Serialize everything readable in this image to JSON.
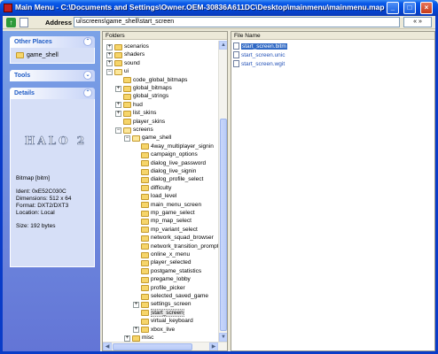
{
  "window": {
    "title": "Main Menu - C:\\Documents and Settings\\Owner.OEM-30836A611DC\\Desktop\\mainmenu\\mainmenu.map",
    "min_glyph": "_",
    "max_glyph": "□",
    "close_glyph": "×"
  },
  "address": {
    "label": "Address",
    "value": "ui\\screens\\game_shell\\start_screen",
    "go_label": "« »"
  },
  "taskpane": {
    "other_places": {
      "title": "Other Places",
      "link": "game_shell"
    },
    "tools": {
      "title": "Tools"
    },
    "details": {
      "title": "Details",
      "logo": "HALO 2",
      "type": "Bitmap [bitm]",
      "ident": "Ident: 0xE52C030C",
      "dimensions": "Dimensions: 512 x 64",
      "format": "Format: DXT2/DXT3",
      "location": "Location: Local",
      "size": "Size: 192 bytes"
    }
  },
  "folders": {
    "header": "Folders",
    "items": [
      {
        "label": "scenarios",
        "exp": "+"
      },
      {
        "label": "shaders",
        "exp": "+"
      },
      {
        "label": "sound",
        "exp": "+"
      },
      {
        "label": "ui",
        "exp": "−"
      },
      {
        "label": "code_global_bitmaps",
        "exp": ""
      },
      {
        "label": "global_bitmaps",
        "exp": "+"
      },
      {
        "label": "global_strings",
        "exp": ""
      },
      {
        "label": "hud",
        "exp": "+"
      },
      {
        "label": "list_skins",
        "exp": "+"
      },
      {
        "label": "player_skins",
        "exp": ""
      },
      {
        "label": "screens",
        "exp": "−"
      },
      {
        "label": "game_shell",
        "exp": "−"
      },
      {
        "label": "4way_multiplayer_signin",
        "exp": ""
      },
      {
        "label": "campaign_options",
        "exp": ""
      },
      {
        "label": "dialog_live_password",
        "exp": ""
      },
      {
        "label": "dialog_live_signin",
        "exp": ""
      },
      {
        "label": "dialog_profile_select",
        "exp": ""
      },
      {
        "label": "difficulty",
        "exp": ""
      },
      {
        "label": "load_level",
        "exp": ""
      },
      {
        "label": "main_menu_screen",
        "exp": ""
      },
      {
        "label": "mp_game_select",
        "exp": ""
      },
      {
        "label": "mp_map_select",
        "exp": ""
      },
      {
        "label": "mp_variant_select",
        "exp": ""
      },
      {
        "label": "network_squad_browser",
        "exp": ""
      },
      {
        "label": "network_transition_prompt",
        "exp": ""
      },
      {
        "label": "online_x_menu",
        "exp": ""
      },
      {
        "label": "player_selected",
        "exp": ""
      },
      {
        "label": "postgame_statistics",
        "exp": ""
      },
      {
        "label": "pregame_lobby",
        "exp": ""
      },
      {
        "label": "profile_picker",
        "exp": ""
      },
      {
        "label": "selected_saved_game",
        "exp": ""
      },
      {
        "label": "settings_screen",
        "exp": "+"
      },
      {
        "label": "start_screen",
        "exp": ""
      },
      {
        "label": "virtual_keyboard",
        "exp": ""
      },
      {
        "label": "xbox_live",
        "exp": "+"
      },
      {
        "label": "misc",
        "exp": "+"
      }
    ]
  },
  "files": {
    "header": "File Name",
    "items": [
      "start_screen.bitm",
      "start_screen.unic",
      "start_screen.wgit"
    ]
  }
}
